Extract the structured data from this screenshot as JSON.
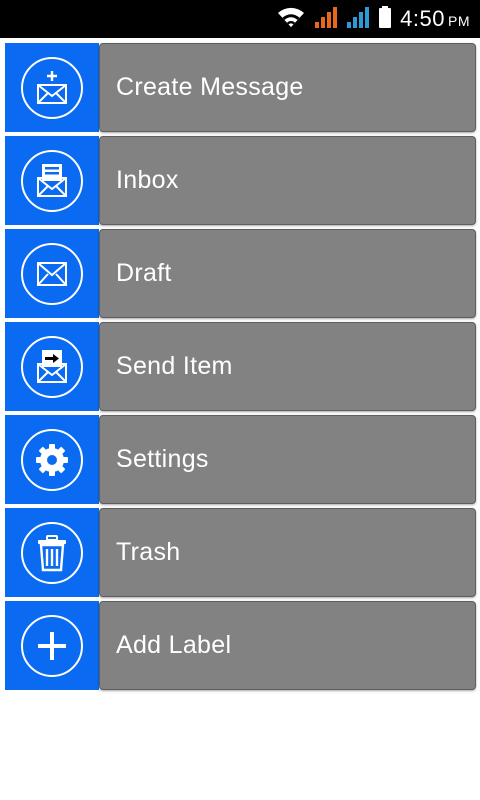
{
  "status_bar": {
    "time": "4:50",
    "ampm": "PM",
    "icons": [
      "wifi-icon",
      "signal-icon-sim1",
      "signal-icon-sim2",
      "battery-icon"
    ],
    "colors": {
      "sim1": "#e8681c",
      "sim2": "#2a9ad8"
    }
  },
  "menu": {
    "accent_color": "#0a6bf2",
    "label_bg": "#828282",
    "items": [
      {
        "label": "Create Message",
        "icon": "create-message-icon"
      },
      {
        "label": "Inbox",
        "icon": "inbox-icon"
      },
      {
        "label": "Draft",
        "icon": "draft-icon"
      },
      {
        "label": "Send Item",
        "icon": "send-item-icon"
      },
      {
        "label": "Settings",
        "icon": "settings-gear-icon"
      },
      {
        "label": "Trash",
        "icon": "trash-icon"
      },
      {
        "label": "Add Label",
        "icon": "add-label-icon"
      }
    ]
  }
}
